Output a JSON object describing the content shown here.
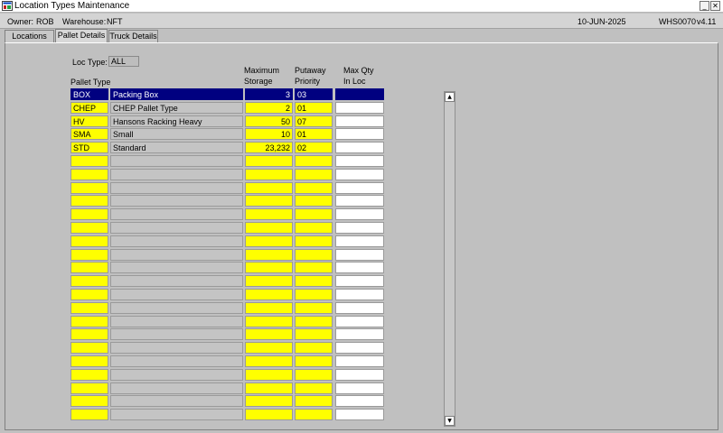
{
  "window": {
    "title": "Location Types Maintenance",
    "minimize_glyph": "_",
    "close_glyph": "✕"
  },
  "infobar": {
    "owner_label": "Owner:",
    "owner_value": "ROB",
    "warehouse_label": "Warehouse:",
    "warehouse_value": "NFT",
    "date": "10-JUN-2025",
    "screen_code": "WHS0070",
    "version": "v4.11"
  },
  "tabs": [
    {
      "label": "Locations",
      "active": false
    },
    {
      "label": "Pallet Details",
      "active": true
    },
    {
      "label": "Truck Details",
      "active": false
    }
  ],
  "form": {
    "loc_type_label": "Loc Type:",
    "loc_type_value": "ALL"
  },
  "table": {
    "columns": {
      "pallet_type": "Pallet Type",
      "max_storage_l1": "Maximum",
      "max_storage_l2": "Storage",
      "putaway_l1": "Putaway",
      "putaway_l2": "Priority",
      "max_qty_l1": "Max Qty",
      "max_qty_l2": "In Loc"
    },
    "rows": [
      {
        "code": "BOX",
        "description": "Packing Box",
        "max_storage": "3",
        "putaway_priority": "03",
        "max_qty": "",
        "selected": true
      },
      {
        "code": "CHEP",
        "description": "CHEP Pallet Type",
        "max_storage": "2",
        "putaway_priority": "01",
        "max_qty": "",
        "selected": false
      },
      {
        "code": "HV",
        "description": "Hansons Racking Heavy",
        "max_storage": "50",
        "putaway_priority": "07",
        "max_qty": "",
        "selected": false
      },
      {
        "code": "SMA",
        "description": "Small",
        "max_storage": "10",
        "putaway_priority": "01",
        "max_qty": "",
        "selected": false
      },
      {
        "code": "STD",
        "description": "Standard",
        "max_storage": "23,232",
        "putaway_priority": "02",
        "max_qty": "",
        "selected": false
      }
    ],
    "visible_row_count": 25
  },
  "scrollbar": {
    "up_glyph": "▲",
    "down_glyph": "▼"
  },
  "colors": {
    "required_field": "#ffff00",
    "selection": "#000080",
    "window_bg": "#c0c0c0"
  },
  "icons": {
    "app": "oracle-forms-app-icon"
  }
}
